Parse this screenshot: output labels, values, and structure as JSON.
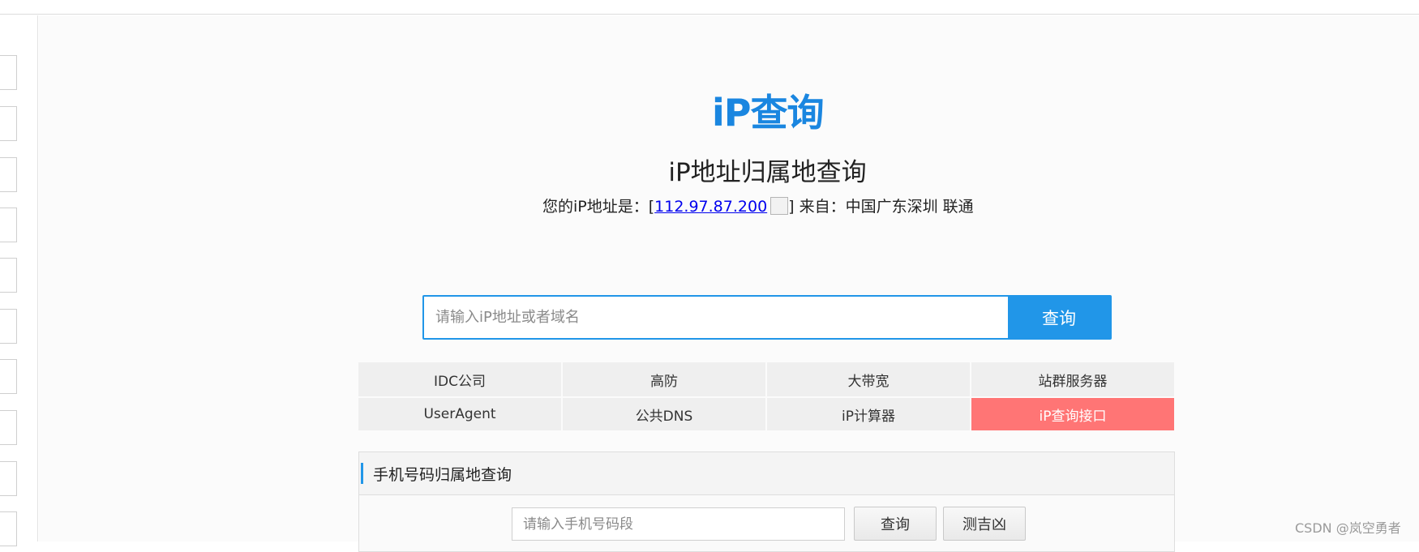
{
  "logo": {
    "text": "iP查询"
  },
  "page": {
    "title": "iP地址归属地查询",
    "ip_label": "您的iP地址是：[",
    "ip_value": "112.97.87.200",
    "ip_suffix": "] 来自：中国广东深圳 联通"
  },
  "search": {
    "placeholder": "请输入iP地址或者域名",
    "button_label": "查询"
  },
  "nav": {
    "items": [
      {
        "label": "IDC公司"
      },
      {
        "label": "高防"
      },
      {
        "label": "大带宽"
      },
      {
        "label": "站群服务器"
      },
      {
        "label": "UserAgent"
      },
      {
        "label": "公共DNS"
      },
      {
        "label": "iP计算器"
      },
      {
        "label": "iP查询接口",
        "highlighted": true
      }
    ]
  },
  "phone": {
    "title": "手机号码归属地查询",
    "placeholder": "请输入手机号码段",
    "query_label": "查询",
    "fortune_label": "测吉凶"
  },
  "watermark": "CSDN @岚空勇者",
  "colors": {
    "accent": "#2196e8",
    "highlight": "#ff7575",
    "logo": "#1a86e0"
  }
}
